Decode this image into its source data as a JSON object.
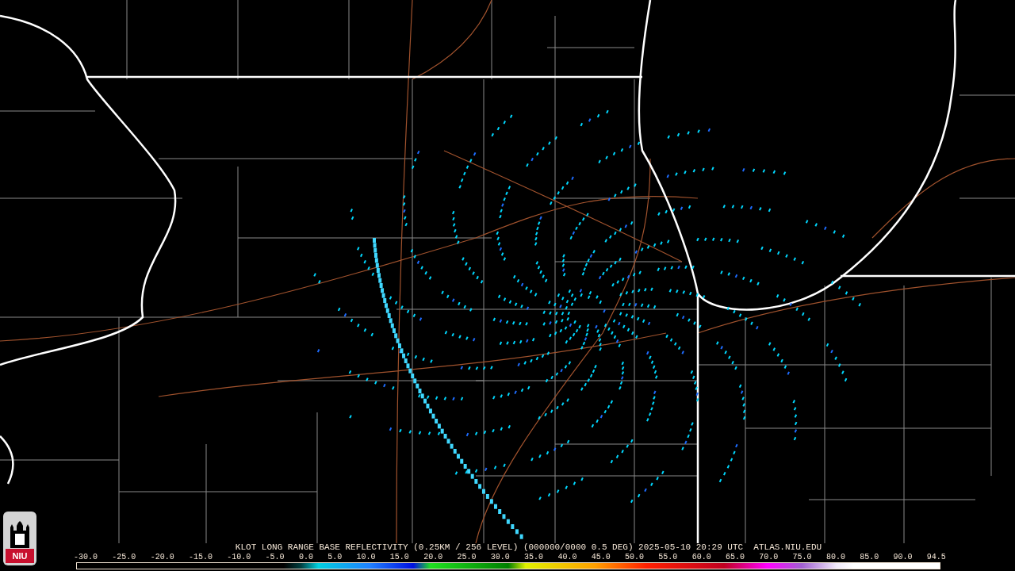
{
  "logo": {
    "text": "NIU"
  },
  "legend": {
    "title": "KLOT LONG RANGE BASE REFLECTIVITY (0.25KM / 256 LEVEL) (000000/0000 0.5 DEG) 2025-05-10 20:29 UTC  ATLAS.NIU.EDU",
    "scale_labels": [
      "-30.0",
      "-25.0",
      "-20.0",
      "-15.0",
      "-10.0",
      "-5.0",
      "0.0",
      "5.0",
      "10.0",
      "15.0",
      "20.0",
      "25.0",
      "30.0",
      "35.0",
      "40.0",
      "45.0",
      "50.0",
      "55.0",
      "60.0",
      "65.0",
      "70.0",
      "75.0",
      "80.0",
      "85.0",
      "90.0",
      "94.5"
    ]
  }
}
